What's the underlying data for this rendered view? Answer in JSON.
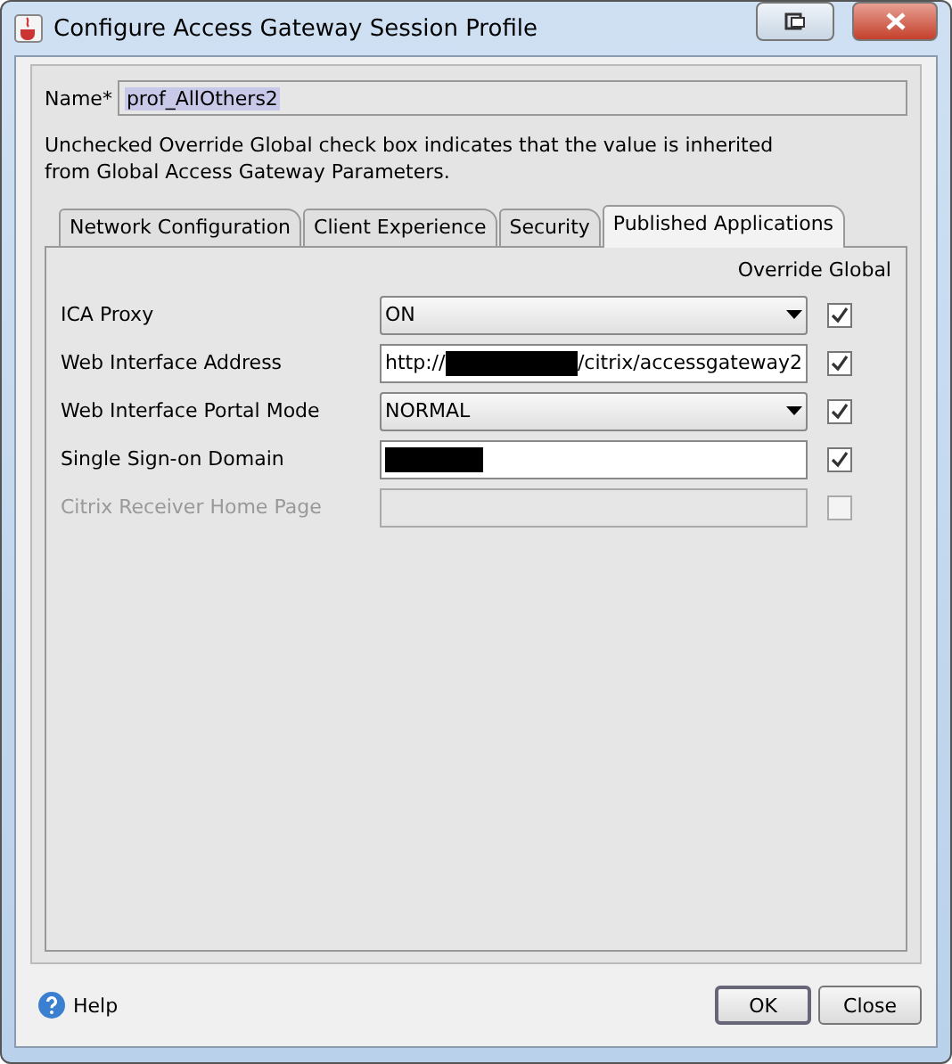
{
  "window": {
    "title": "Configure Access Gateway Session Profile"
  },
  "name_field": {
    "label": "Name*",
    "value": "prof_AllOthers2"
  },
  "description": "Unchecked Override Global check box indicates that the value is inherited from Global Access Gateway Parameters.",
  "tabs": [
    {
      "label": "Network Configuration",
      "selected": false
    },
    {
      "label": "Client Experience",
      "selected": false
    },
    {
      "label": "Security",
      "selected": false
    },
    {
      "label": "Published Applications",
      "selected": true
    }
  ],
  "override_header": "Override Global",
  "rows": [
    {
      "kind": "dropdown",
      "label": "ICA Proxy",
      "value": "ON",
      "disabled": false,
      "checked": true
    },
    {
      "kind": "text",
      "label": "Web Interface Address",
      "value_prefix": "http://",
      "redacted": true,
      "value_suffix": "/citrix/accessgateway2",
      "disabled": false,
      "checked": true
    },
    {
      "kind": "dropdown",
      "label": "Web Interface Portal Mode",
      "value": "NORMAL",
      "disabled": false,
      "checked": true
    },
    {
      "kind": "text",
      "label": "Single Sign-on Domain",
      "redacted": true,
      "disabled": false,
      "checked": true
    },
    {
      "kind": "text",
      "label": "Citrix Receiver Home Page",
      "disabled": true,
      "checked": false
    }
  ],
  "buttons": {
    "help": "Help",
    "ok": "OK",
    "close": "Close"
  }
}
